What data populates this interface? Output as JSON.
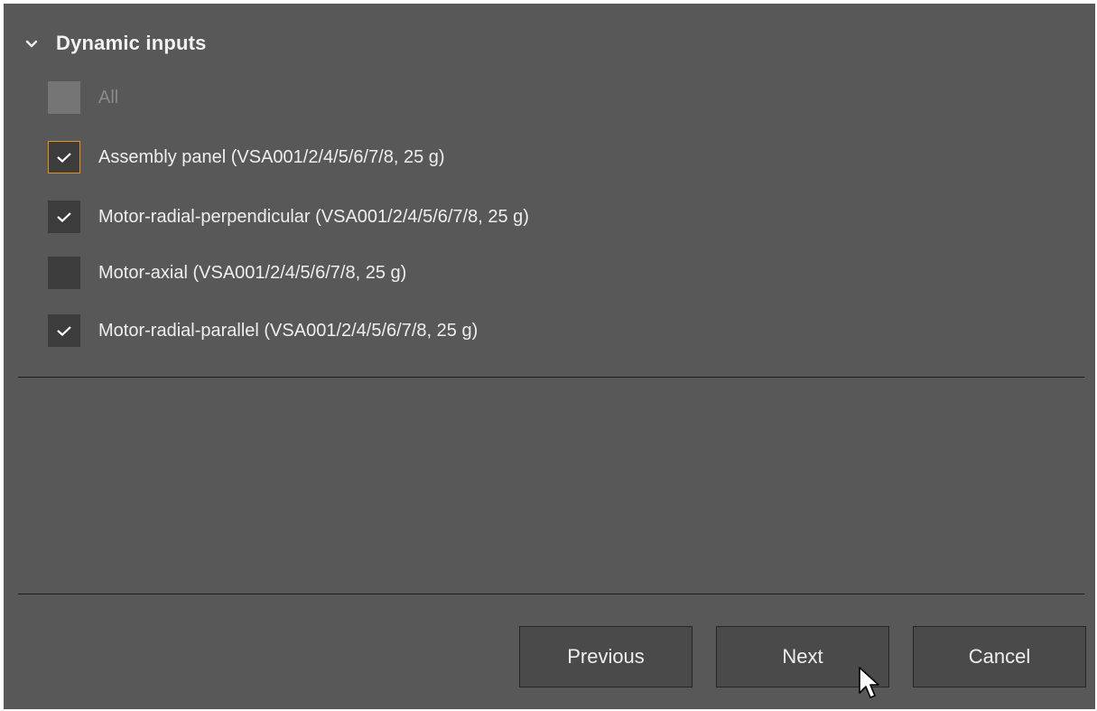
{
  "section": {
    "title": "Dynamic inputs",
    "expanded": true
  },
  "options": [
    {
      "label": "All",
      "checked": false,
      "disabled": true,
      "focused": false
    },
    {
      "label": "Assembly panel (VSA001/2/4/5/6/7/8, 25 g)",
      "checked": true,
      "disabled": false,
      "focused": true
    },
    {
      "label": "Motor-radial-perpendicular (VSA001/2/4/5/6/7/8, 25 g)",
      "checked": true,
      "disabled": false,
      "focused": false
    },
    {
      "label": "Motor-axial (VSA001/2/4/5/6/7/8, 25 g)",
      "checked": false,
      "disabled": false,
      "focused": false
    },
    {
      "label": "Motor-radial-parallel (VSA001/2/4/5/6/7/8, 25 g)",
      "checked": true,
      "disabled": false,
      "focused": false
    }
  ],
  "buttons": {
    "previous": "Previous",
    "next": "Next",
    "cancel": "Cancel"
  },
  "colors": {
    "panel_bg": "#585858",
    "checkbox_bg": "#3c3c3c",
    "focus_border": "#e8941a",
    "text": "#eeeeee"
  }
}
